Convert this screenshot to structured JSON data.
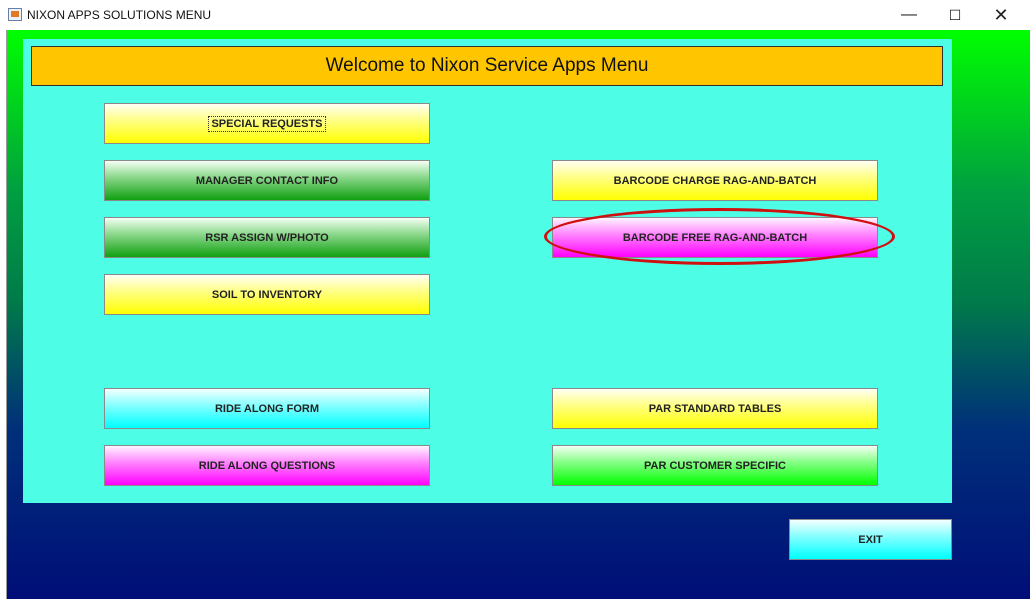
{
  "window": {
    "title": "NIXON APPS SOLUTIONS MENU",
    "minimize_glyph": "—",
    "maximize_glyph": "☐",
    "close_glyph": "✕"
  },
  "header": {
    "title": "Welcome to Nixon Service Apps Menu"
  },
  "buttons": {
    "special_requests": "SPECIAL REQUESTS",
    "manager_contact": "MANAGER CONTACT INFO",
    "rsr_assign": "RSR ASSIGN W/PHOTO",
    "soil_inventory": "SOIL TO INVENTORY",
    "ride_along_form": "RIDE ALONG FORM",
    "ride_along_questions": "RIDE ALONG QUESTIONS",
    "barcode_charge": "BARCODE CHARGE RAG-AND-BATCH",
    "barcode_free": "BARCODE FREE RAG-AND-BATCH",
    "par_standard": "PAR STANDARD TABLES",
    "par_customer": "PAR CUSTOMER SPECIFIC",
    "exit": "EXIT"
  },
  "colors": {
    "panel": "#4efde6",
    "header": "#ffc600",
    "highlight_oval": "#d01010"
  },
  "icons": {
    "app": "java-app-icon"
  }
}
